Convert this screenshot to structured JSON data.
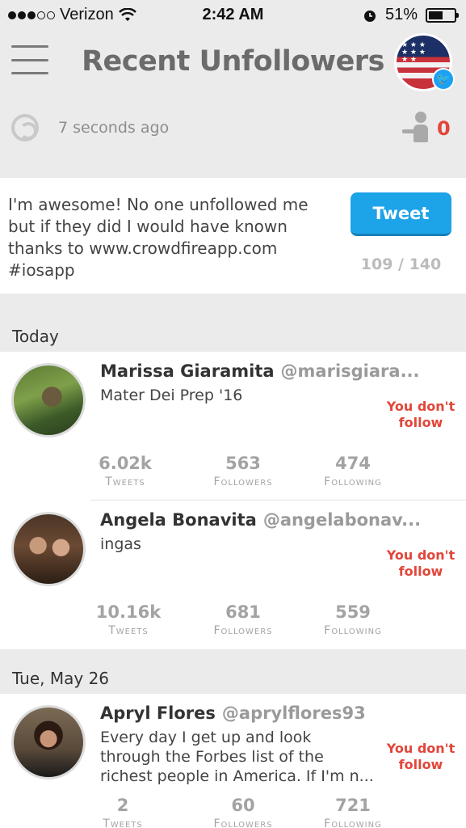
{
  "status_bar": {
    "carrier": "Verizon",
    "time": "2:42 AM",
    "battery": "51%",
    "battery_level": 0.51
  },
  "header": {
    "title": "Recent Unfollowers"
  },
  "refresh": {
    "updated_text": "7 seconds ago",
    "unfollower_count": "0"
  },
  "tweet_card": {
    "text": "I'm awesome! No one unfollowed me but if they did I would have known thanks to www.crowdfireapp.com #iosapp",
    "button_label": "Tweet",
    "char_count": "109 / 140"
  },
  "sections": [
    {
      "label": "Today",
      "users": [
        {
          "name": "Marissa Giaramita",
          "handle": "@marisgiara...",
          "bio": "Mater Dei Prep '16",
          "status": "You don't follow",
          "tweets": "6.02k",
          "followers": "563",
          "following": "474"
        },
        {
          "name": "Angela Bonavita",
          "handle": "@angelabonav...",
          "bio": "ingas",
          "status": "You don't follow",
          "tweets": "10.16k",
          "followers": "681",
          "following": "559"
        }
      ]
    },
    {
      "label": "Tue, May 26",
      "users": [
        {
          "name": "Apryl Flores",
          "handle": "@aprylflores93",
          "bio": "Every day I get up and look through the Forbes list of the richest people in America. If I'm n...",
          "status": "You don't follow",
          "tweets": "2",
          "followers": "60",
          "following": "721"
        }
      ]
    }
  ],
  "stat_labels": {
    "tweets": "Tweets",
    "followers": "Followers",
    "following": "Following"
  }
}
